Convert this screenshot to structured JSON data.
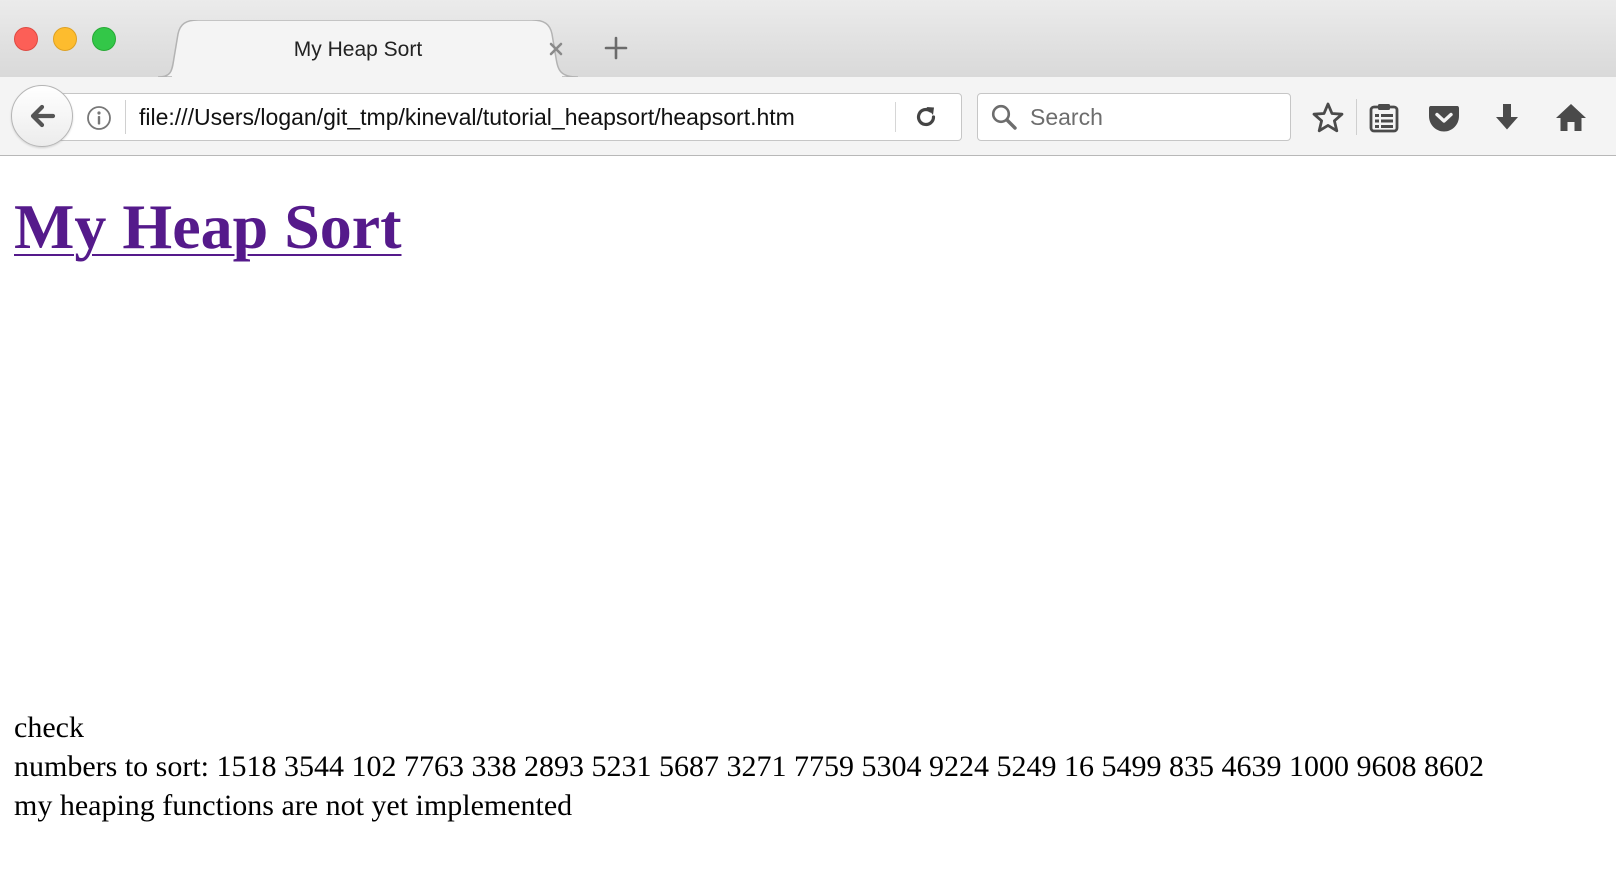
{
  "window": {
    "traffic_lights": [
      "close",
      "minimize",
      "zoom"
    ]
  },
  "tab": {
    "title": "My Heap Sort"
  },
  "navigation": {
    "url": "file:///Users/logan/git_tmp/kineval/tutorial_heapsort/heapsort.htm",
    "search_placeholder": "Search"
  },
  "toolbar": {
    "icons": [
      "bookmark-star-icon",
      "reading-list-icon",
      "pocket-icon",
      "download-icon",
      "home-icon"
    ]
  },
  "page": {
    "title": "My Heap Sort",
    "lines": [
      "check",
      "numbers to sort: 1518 3544 102 7763 338 2893 5231 5687 3271 7759 5304 9224 5249 16 5499 835 4639 1000 9608 8602",
      "my heaping functions are not yet implemented"
    ]
  },
  "colors": {
    "visited_link": "#551a8b",
    "close_light": "#fc5f57",
    "minimize_light": "#fdbc2e",
    "zoom_light": "#33c748"
  }
}
